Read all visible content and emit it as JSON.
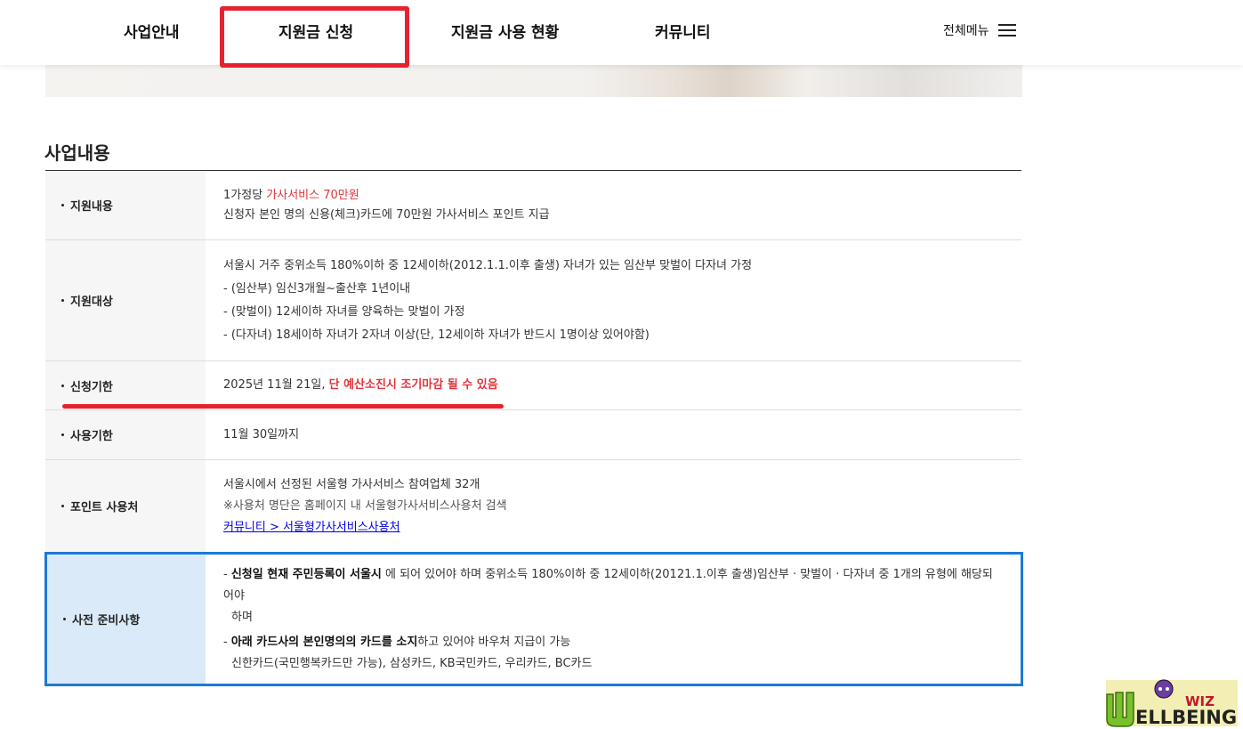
{
  "header": {
    "nav": [
      "사업안내",
      "지원금 신청",
      "지원금 사용 현황",
      "커뮤니티"
    ],
    "all_menu": "전체메뉴"
  },
  "section_title": "사업내용",
  "rows": {
    "support_content": {
      "label": "지원내용",
      "line1_prefix": "1가정당 ",
      "line1_highlight": "가사서비스 70만원",
      "line2": "신청자 본인 명의 신용(체크)카드에 70만원 가사서비스 포인트 지급"
    },
    "support_target": {
      "label": "지원대상",
      "lines": [
        "서울시 거주 중위소득 180%이하 중 12세이하(2012.1.1.이후 출생) 자녀가 있는 임산부 맞벌이 다자녀 가정",
        "- (임산부) 임신3개월~출산후 1년이내",
        "- (맞벌이) 12세이하 자녀를 양육하는 맞벌이 가정",
        "- (다자녀) 18세이하 자녀가 2자녀 이상(단, 12세이하 자녀가 반드시 1명이상 있어야함)"
      ]
    },
    "apply_deadline": {
      "label": "신청기한",
      "date": "2025년 11월 21일, ",
      "warning": "단 예산소진시 조기마감 될 수 있음"
    },
    "use_deadline": {
      "label": "사용기한",
      "value": "11월 30일까지"
    },
    "point_usage": {
      "label": "포인트 사용처",
      "line1": "서울시에서 선정된 서울형 가사서비스 참여업체 32개",
      "note": "※사용처 명단은 홈페이지 내 서울형가사서비스사용처 검색",
      "link": "커뮤니티 > 서울형가사서비스사용처"
    },
    "preparation": {
      "label": "사전 준비사항",
      "item1_dash": "- ",
      "item1_bold": "신청일 현재 주민등록이 서울시",
      "item1_rest": " 에 되어 있어야 하며 중위소득 180%이하 중 12세이하(20121.1.이후 출생)임산부 · 맞벌이 · 다자녀 중 1개의 유형에 해당되어야",
      "item1_cont": "하며",
      "item2_dash": "- ",
      "item2_bold": "아래 카드사의 본인명의의 카드를 소지",
      "item2_rest": "하고 있어야 바우처 지급이 가능",
      "item2_cards": "신한카드(국민행복카드만 가능), 삼성카드, KB국민카드, 우리카드, BC카드"
    }
  },
  "watermark": {
    "top": "WIZ",
    "bottom": "ELLBEING"
  },
  "colors": {
    "highlight_red": "#e5232e",
    "text_red": "#e0343c",
    "accent_blue": "#1c7ad6",
    "prep_label_bg": "#daeaf8"
  }
}
